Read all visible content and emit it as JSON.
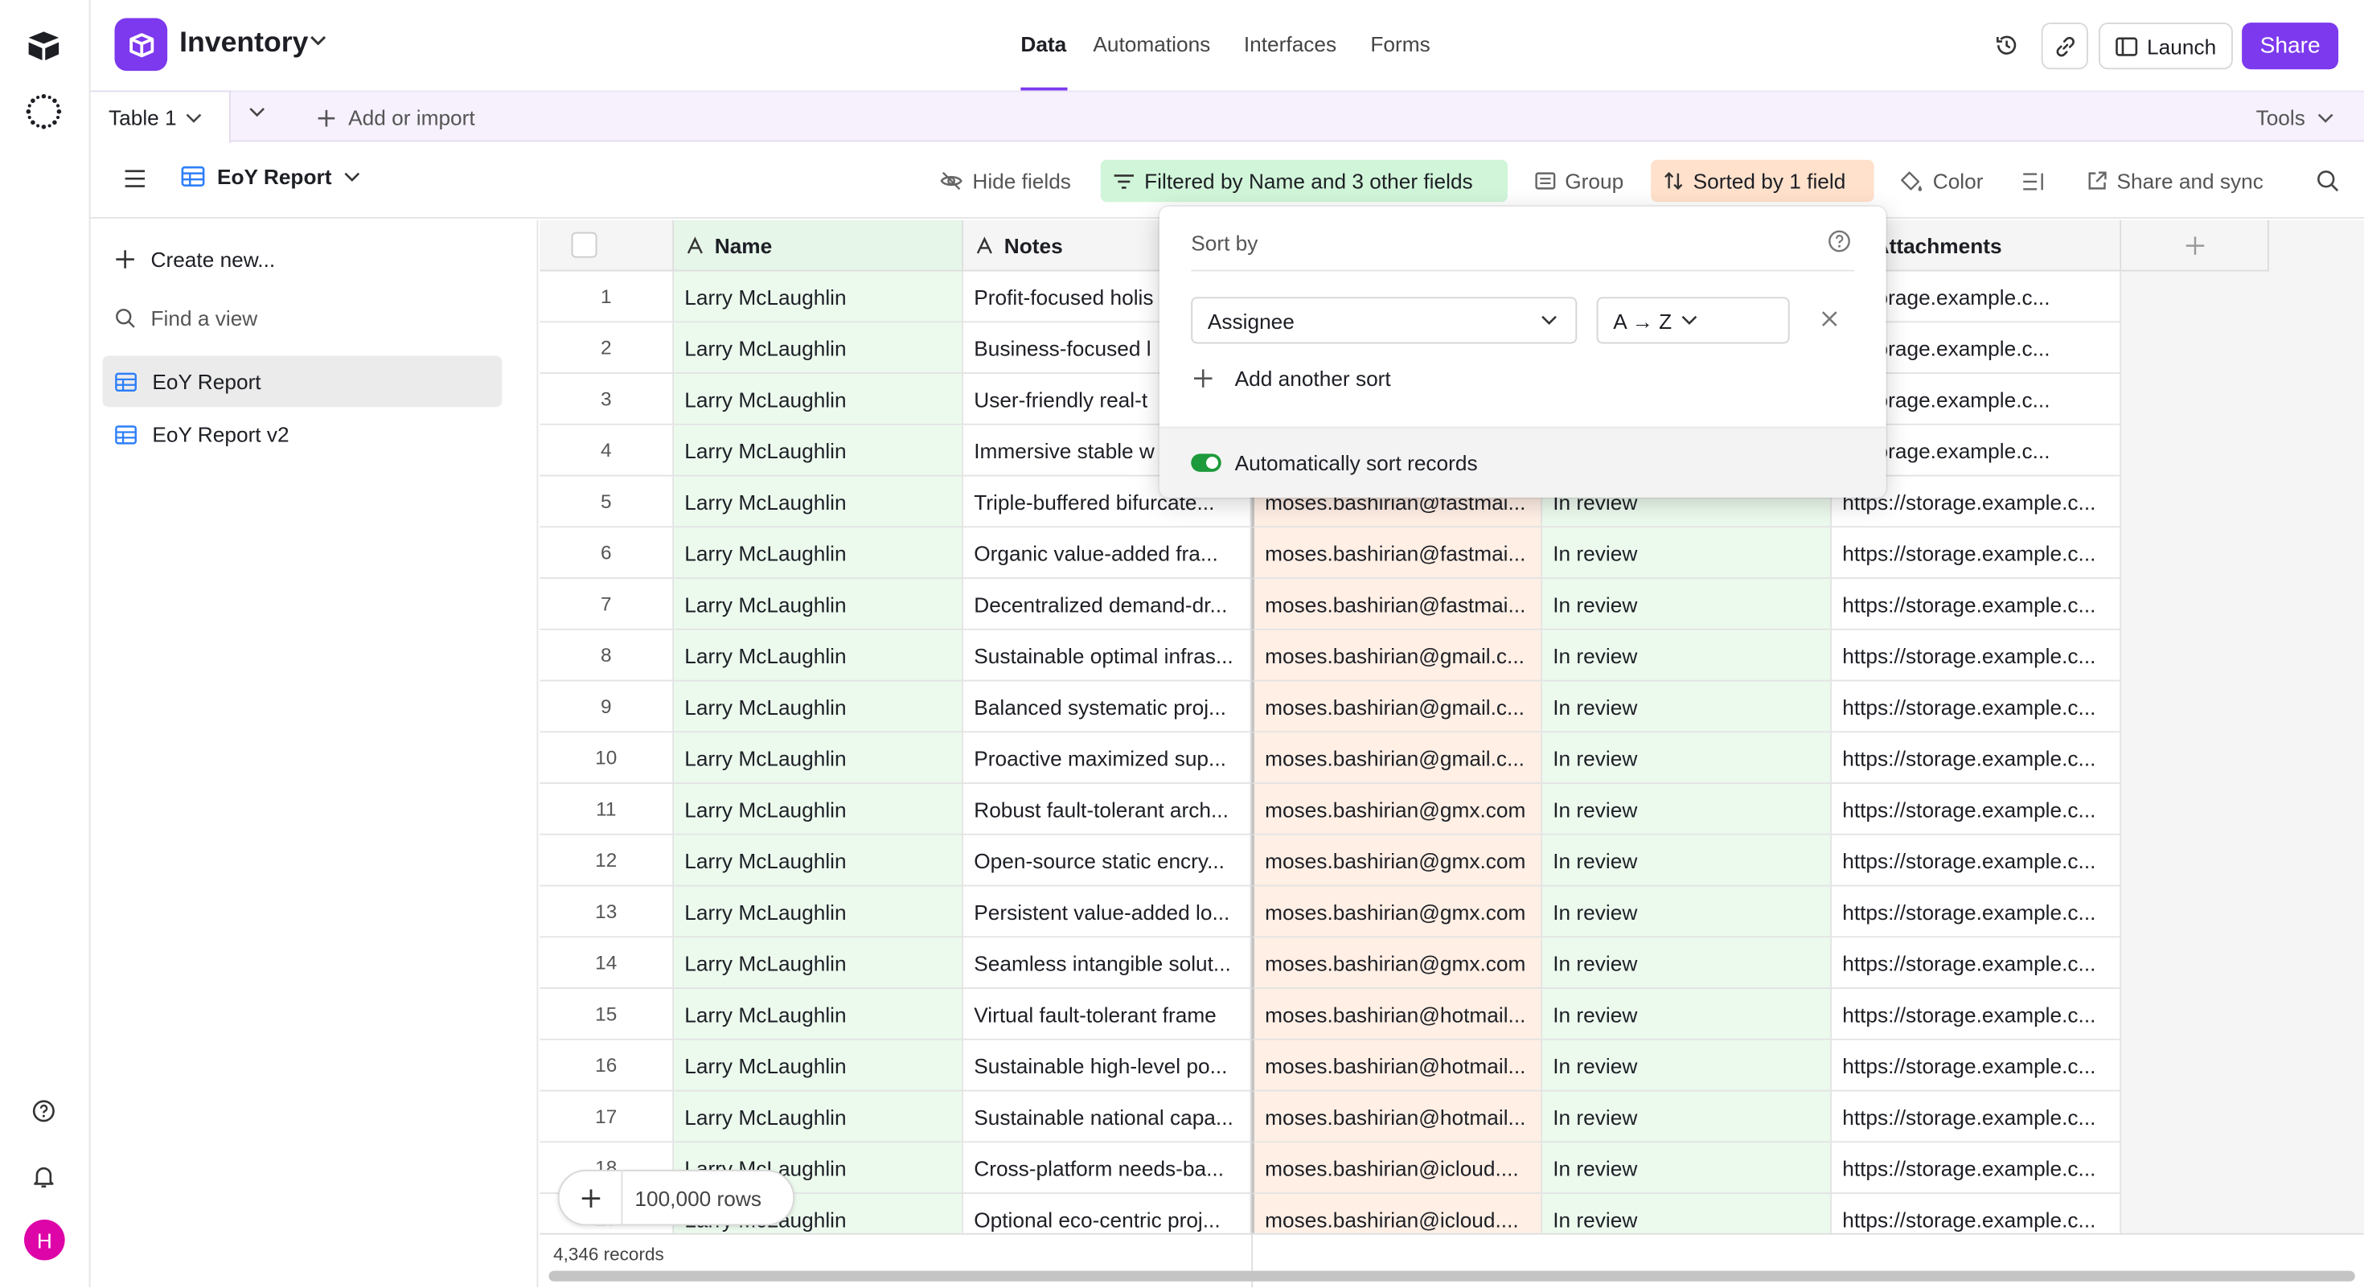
{
  "app": {
    "title": "Inventory"
  },
  "nav": {
    "tabs": [
      "Data",
      "Automations",
      "Interfaces",
      "Forms"
    ],
    "active": "Data"
  },
  "header_actions": {
    "launch": "Launch",
    "share": "Share"
  },
  "tabbar": {
    "table_tab": "Table 1",
    "add_import": "Add or import",
    "tools": "Tools"
  },
  "toolbar": {
    "view_name": "EoY Report",
    "hide_fields": "Hide fields",
    "filter": "Filtered by Name and 3 other fields",
    "group": "Group",
    "sort": "Sorted by 1 field",
    "color": "Color",
    "share_sync": "Share and sync"
  },
  "sidebar": {
    "create_new": "Create new...",
    "find_view": "Find a view",
    "views": [
      "EoY Report",
      "EoY Report v2"
    ]
  },
  "grid": {
    "columns": [
      "Name",
      "Notes",
      "Attachments"
    ],
    "rows": [
      [
        "1",
        "Larry McLaughlin",
        "Profit-focused holis",
        "",
        "",
        "://storage.example.c..."
      ],
      [
        "2",
        "Larry McLaughlin",
        "Business-focused l",
        "",
        "",
        "://storage.example.c..."
      ],
      [
        "3",
        "Larry McLaughlin",
        "User-friendly real-t",
        "",
        "",
        "://storage.example.c..."
      ],
      [
        "4",
        "Larry McLaughlin",
        "Immersive stable w",
        "",
        "",
        "://storage.example.c..."
      ],
      [
        "5",
        "Larry McLaughlin",
        "Triple-buffered bifurcate...",
        "moses.bashirian@fastmai...",
        "In review",
        "https://storage.example.c..."
      ],
      [
        "6",
        "Larry McLaughlin",
        "Organic value-added fra...",
        "moses.bashirian@fastmai...",
        "In review",
        "https://storage.example.c..."
      ],
      [
        "7",
        "Larry McLaughlin",
        "Decentralized demand-dr...",
        "moses.bashirian@fastmai...",
        "In review",
        "https://storage.example.c..."
      ],
      [
        "8",
        "Larry McLaughlin",
        "Sustainable optimal infras...",
        "moses.bashirian@gmail.c...",
        "In review",
        "https://storage.example.c..."
      ],
      [
        "9",
        "Larry McLaughlin",
        "Balanced systematic proj...",
        "moses.bashirian@gmail.c...",
        "In review",
        "https://storage.example.c..."
      ],
      [
        "10",
        "Larry McLaughlin",
        "Proactive maximized sup...",
        "moses.bashirian@gmail.c...",
        "In review",
        "https://storage.example.c..."
      ],
      [
        "11",
        "Larry McLaughlin",
        "Robust fault-tolerant arch...",
        "moses.bashirian@gmx.com",
        "In review",
        "https://storage.example.c..."
      ],
      [
        "12",
        "Larry McLaughlin",
        "Open-source static encry...",
        "moses.bashirian@gmx.com",
        "In review",
        "https://storage.example.c..."
      ],
      [
        "13",
        "Larry McLaughlin",
        "Persistent value-added lo...",
        "moses.bashirian@gmx.com",
        "In review",
        "https://storage.example.c..."
      ],
      [
        "14",
        "Larry McLaughlin",
        "Seamless intangible solut...",
        "moses.bashirian@gmx.com",
        "In review",
        "https://storage.example.c..."
      ],
      [
        "15",
        "Larry McLaughlin",
        "Virtual fault-tolerant frame",
        "moses.bashirian@hotmail...",
        "In review",
        "https://storage.example.c..."
      ],
      [
        "16",
        "Larry McLaughlin",
        "Sustainable high-level po...",
        "moses.bashirian@hotmail...",
        "In review",
        "https://storage.example.c..."
      ],
      [
        "17",
        "Larry McLaughlin",
        "Sustainable national capa...",
        "moses.bashirian@hotmail...",
        "In review",
        "https://storage.example.c..."
      ],
      [
        "18",
        "Larry McLaughlin",
        "Cross-platform needs-ba...",
        "moses.bashirian@icloud....",
        "In review",
        "https://storage.example.c..."
      ],
      [
        "19",
        "Larry McLaughlin",
        "Optional eco-centric proj...",
        "moses.bashirian@icloud....",
        "In review",
        "https://storage.example.c..."
      ]
    ]
  },
  "footer": {
    "records": "4,346 records",
    "add_rows": "100,000 rows"
  },
  "sort_popup": {
    "title": "Sort by",
    "field": "Assignee",
    "direction": "A → Z",
    "add_another": "Add another sort",
    "auto_sort_label": "Automatically sort records",
    "auto_sort_enabled": true
  },
  "user": {
    "avatar_initial": "H"
  },
  "colors": {
    "accent": "#7c39ed",
    "filter_bg": "#d1f5d9",
    "sort_bg": "#ffe1cc",
    "toggle_on": "#1d9a3b",
    "avatar": "#dd04a8"
  }
}
